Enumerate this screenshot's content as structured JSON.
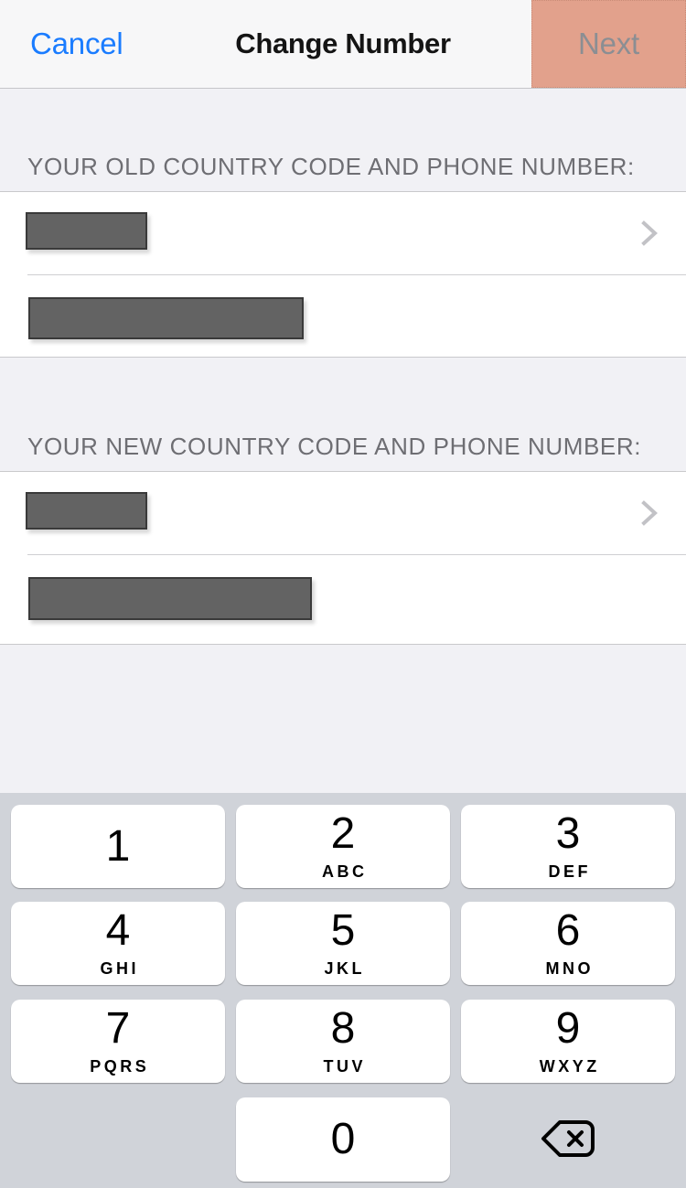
{
  "navbar": {
    "cancel_label": "Cancel",
    "title": "Change Number",
    "next_label": "Next",
    "next_highlight_color": "#e2a18c",
    "cancel_color": "#1a7cff",
    "next_color": "#8b8e93"
  },
  "sections": [
    {
      "header": "YOUR OLD COUNTRY CODE AND PHONE NUMBER:",
      "rows": [
        {
          "kind": "country-code",
          "value_redacted": true,
          "has_chevron": true
        },
        {
          "kind": "phone-number",
          "value_redacted": true,
          "has_chevron": false
        }
      ]
    },
    {
      "header": "YOUR NEW COUNTRY CODE AND PHONE NUMBER:",
      "rows": [
        {
          "kind": "country-code",
          "value_redacted": true,
          "has_chevron": true
        },
        {
          "kind": "phone-number",
          "value_redacted": true,
          "has_chevron": false
        }
      ]
    }
  ],
  "icons": {
    "chevron": "chevron-right-icon",
    "backspace": "backspace-delete-icon"
  },
  "keyboard": {
    "background_color": "#d0d3d9",
    "key_color": "#ffffff",
    "keys": [
      {
        "digit": "1",
        "letters": ""
      },
      {
        "digit": "2",
        "letters": "ABC"
      },
      {
        "digit": "3",
        "letters": "DEF"
      },
      {
        "digit": "4",
        "letters": "GHI"
      },
      {
        "digit": "5",
        "letters": "JKL"
      },
      {
        "digit": "6",
        "letters": "MNO"
      },
      {
        "digit": "7",
        "letters": "PQRS"
      },
      {
        "digit": "8",
        "letters": "TUV"
      },
      {
        "digit": "9",
        "letters": "WXYZ"
      },
      {
        "digit": "0",
        "letters": ""
      }
    ]
  }
}
